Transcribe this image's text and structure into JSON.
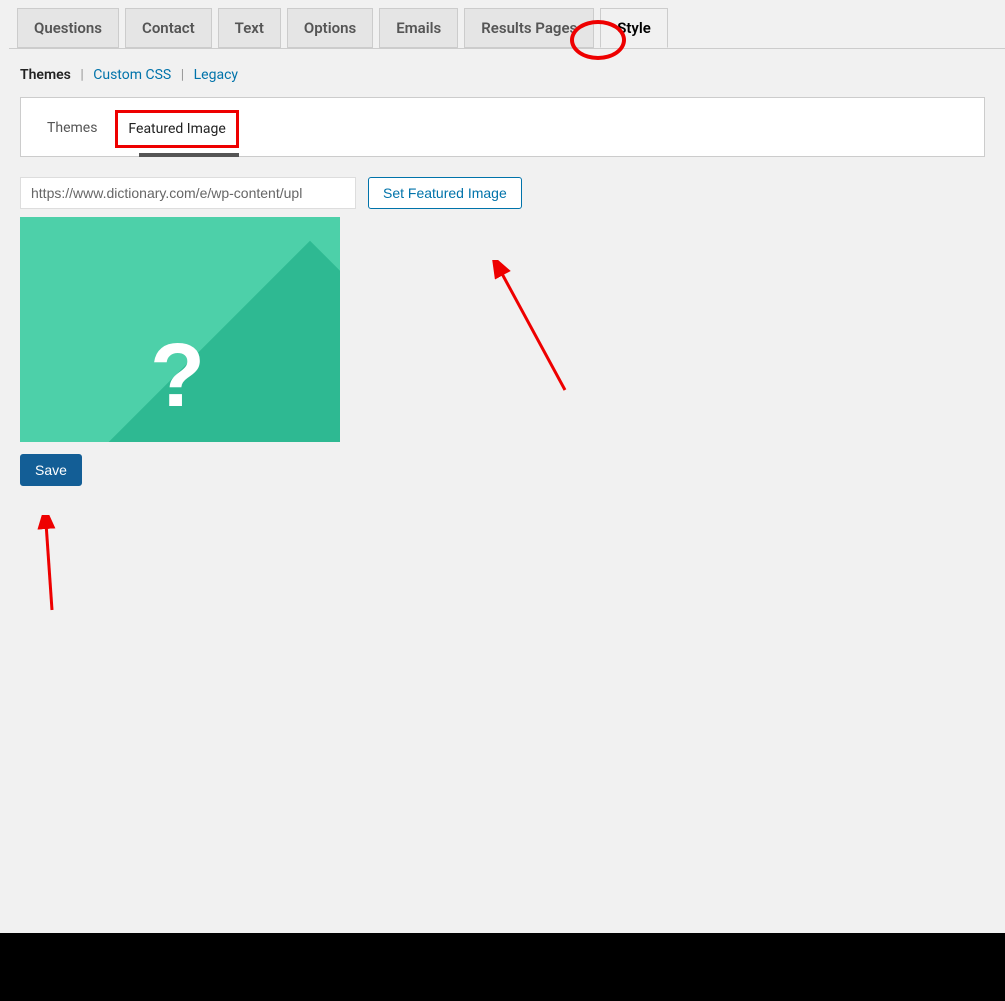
{
  "mainTabs": {
    "questions": "Questions",
    "contact": "Contact",
    "text": "Text",
    "options": "Options",
    "emails": "Emails",
    "resultsPages": "Results Pages",
    "style": "Style"
  },
  "sublinks": {
    "themes": "Themes",
    "customCss": "Custom CSS",
    "legacy": "Legacy"
  },
  "subtabs": {
    "themes": "Themes",
    "featuredImage": "Featured Image"
  },
  "form": {
    "urlValue": "https://www.dictionary.com/e/wp-content/upl",
    "setButton": "Set Featured Image",
    "saveButton": "Save"
  }
}
